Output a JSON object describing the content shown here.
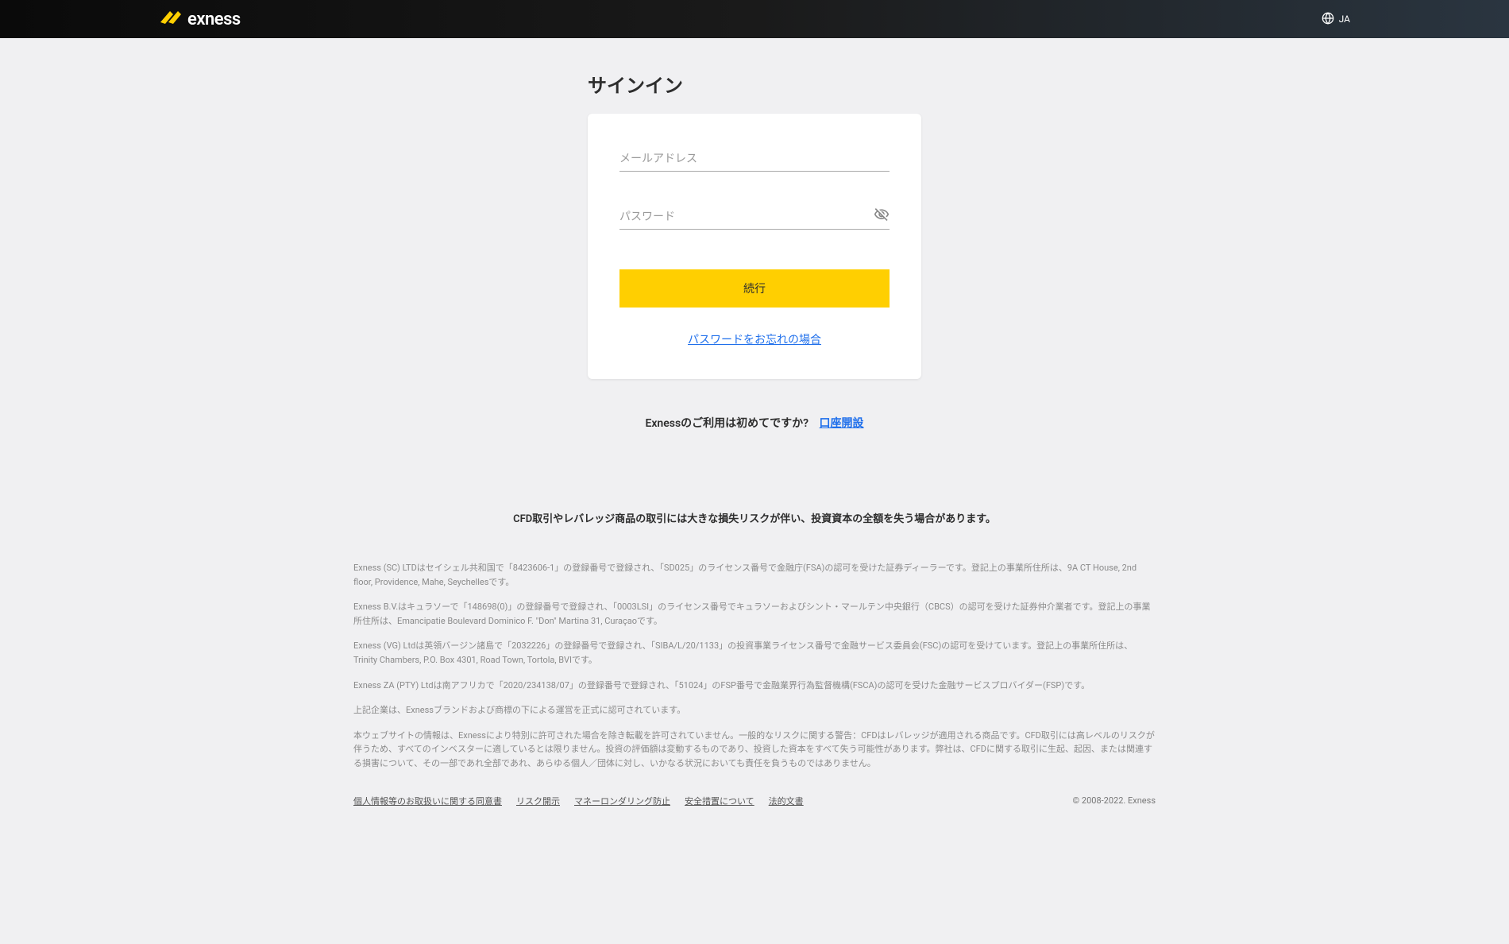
{
  "header": {
    "logo_text": "exness",
    "language": "JA"
  },
  "signin": {
    "title": "サインイン",
    "email_placeholder": "メールアドレス",
    "password_placeholder": "パスワード",
    "continue_label": "続行",
    "forgot_password": "パスワードをお忘れの場合"
  },
  "signup": {
    "prompt": "Exnessのご利用は初めてですか?",
    "link": "口座開設"
  },
  "disclaimer": "CFD取引やレバレッジ商品の取引には大きな損失リスクが伴い、投資資本の全額を失う場合があります。",
  "legal": {
    "p1": "Exness (SC) LTDはセイシェル共和国で「8423606-1」の登録番号で登録され、「SD025」のライセンス番号で金融庁(FSA)の認可を受けた証券ディーラーです。登記上の事業所住所は、9A CT House, 2nd floor, Providence, Mahe, Seychellesです。",
    "p2": "Exness B.V.はキュラソーで「148698(0)」の登録番号で登録され、「0003LSI」のライセンス番号でキュラソーおよびシント・マールテン中央銀行（CBCS）の認可を受けた証券仲介業者です。登記上の事業所住所は、Emancipatie Boulevard Dominico F. \"Don\" Martina 31, Curaçaoです。",
    "p3": "Exness (VG) Ltdは英領バージン諸島で「2032226」の登録番号で登録され、「SIBA/L/20/1133」の投資事業ライセンス番号で金融サービス委員会(FSC)の認可を受けています。登記上の事業所住所は、Trinity Chambers, P.O. Box 4301, Road Town, Tortola, BVIです。",
    "p4": "Exness ZA (PTY) Ltdは南アフリカで「2020/234138/07」の登録番号で登録され、「51024」のFSP番号で金融業界行為監督機構(FSCA)の認可を受けた金融サービスプロバイダー(FSP)です。",
    "p5": "上記企業は、Exnessブランドおよび商標の下による運営を正式に認可されています。",
    "p6": "本ウェブサイトの情報は、Exnessにより特別に許可された場合を除き転載を許可されていません。一般的なリスクに関する警告：CFDはレバレッジが適用される商品です。CFD取引には高レベルのリスクが伴うため、すべてのインベスターに適しているとは限りません。投資の評価額は変動するものであり、投資した資本をすべて失う可能性があります。弊社は、CFDに関する取引に生起、起因、または関連する損害について、その一部であれ全部であれ、あらゆる個人／団体に対し、いかなる状況においても責任を負うものではありません。"
  },
  "footer": {
    "links": [
      "個人情報等のお取扱いに関する同意書",
      "リスク開示",
      "マネーロンダリング防止",
      "安全措置について",
      "法的文書"
    ],
    "copyright": "© 2008-2022. Exness"
  }
}
